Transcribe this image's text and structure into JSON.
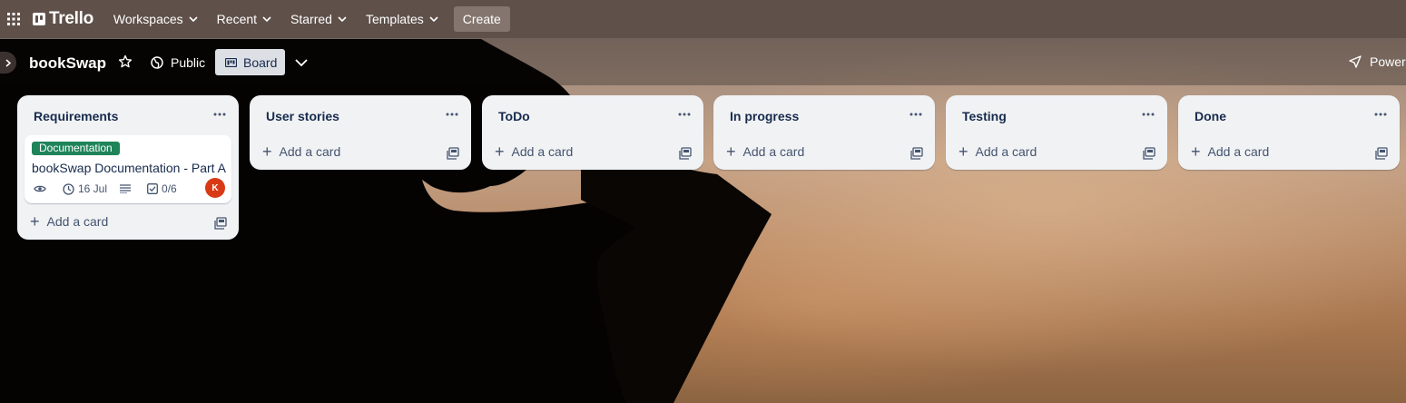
{
  "header": {
    "logo_text": "Trello",
    "nav": [
      {
        "label": "Workspaces"
      },
      {
        "label": "Recent"
      },
      {
        "label": "Starred"
      },
      {
        "label": "Templates"
      }
    ],
    "create_label": "Create"
  },
  "board": {
    "title": "bookSwap",
    "visibility_label": "Public",
    "view_label": "Board",
    "powerups_label": "Power-"
  },
  "lists": [
    {
      "title": "Requirements",
      "add_label": "Add a card",
      "cards": [
        {
          "label": "Documentation",
          "label_color": "#1f845a",
          "title": "bookSwap Documentation - Part A",
          "due": "16 Jul",
          "checklist": "0/6",
          "member_initial": "K",
          "member_color": "#d93a16"
        }
      ]
    },
    {
      "title": "User stories",
      "add_label": "Add a card",
      "cards": []
    },
    {
      "title": "ToDo",
      "add_label": "Add a card",
      "cards": []
    },
    {
      "title": "In progress",
      "add_label": "Add a card",
      "cards": []
    },
    {
      "title": "Testing",
      "add_label": "Add a card",
      "cards": []
    },
    {
      "title": "Done",
      "add_label": "Add a card",
      "cards": []
    }
  ],
  "icons": {
    "apps": "apps-grid-icon",
    "star": "star-icon",
    "public": "globe-icon",
    "board_view": "board-view-icon",
    "chevron": "chevron-down-icon",
    "powerups": "rocket-icon",
    "list_menu": "more-icon",
    "template": "card-template-icon",
    "watch": "eye-icon",
    "due": "clock-icon",
    "description": "description-icon",
    "checklist": "checklist-icon"
  }
}
